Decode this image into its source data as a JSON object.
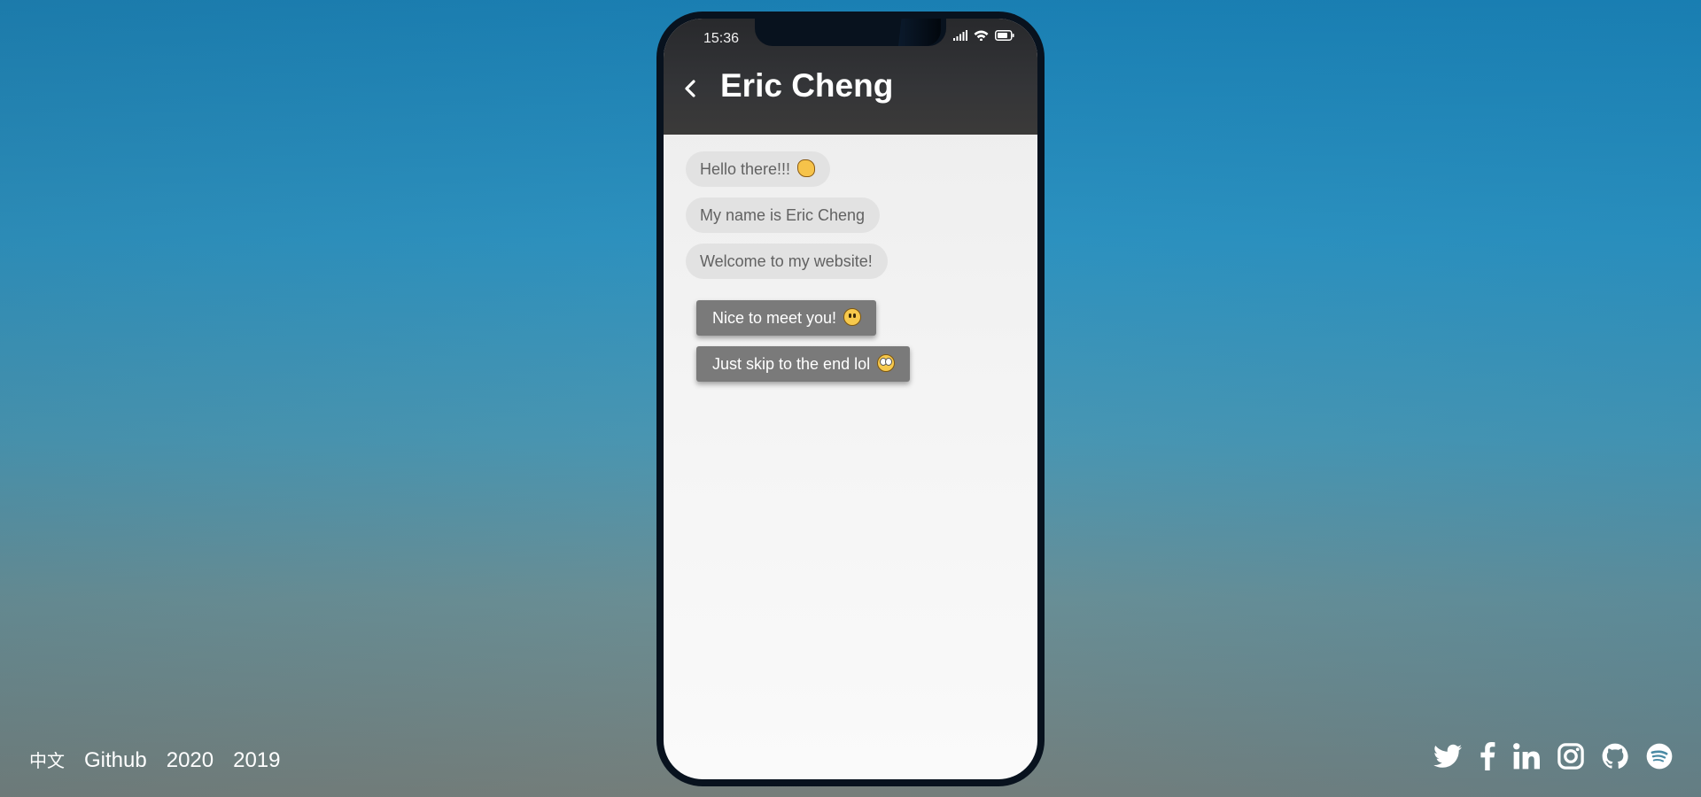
{
  "status_bar": {
    "time": "15:36"
  },
  "header": {
    "title": "Eric Cheng"
  },
  "messages": [
    {
      "text": "Hello there!!!",
      "emoji": "waving-hand-emoji"
    },
    {
      "text": "My name is Eric Cheng"
    },
    {
      "text": "Welcome to my website!"
    }
  ],
  "replies": [
    {
      "text": "Nice to meet you!",
      "emoji": "smiley-emoji"
    },
    {
      "text": "Just skip to the end lol",
      "emoji": "eye-roll-emoji"
    }
  ],
  "footer": {
    "links": [
      "中文",
      "Github",
      "2020",
      "2019"
    ],
    "social_icons": [
      "twitter-icon",
      "facebook-icon",
      "linkedin-icon",
      "instagram-icon",
      "github-icon",
      "spotify-icon"
    ]
  },
  "colors": {
    "header_bg": "#343538",
    "bubble_bg": "#e2e2e2",
    "reply_bg": "#7a7a7a",
    "phone_frame": "#08121e"
  }
}
